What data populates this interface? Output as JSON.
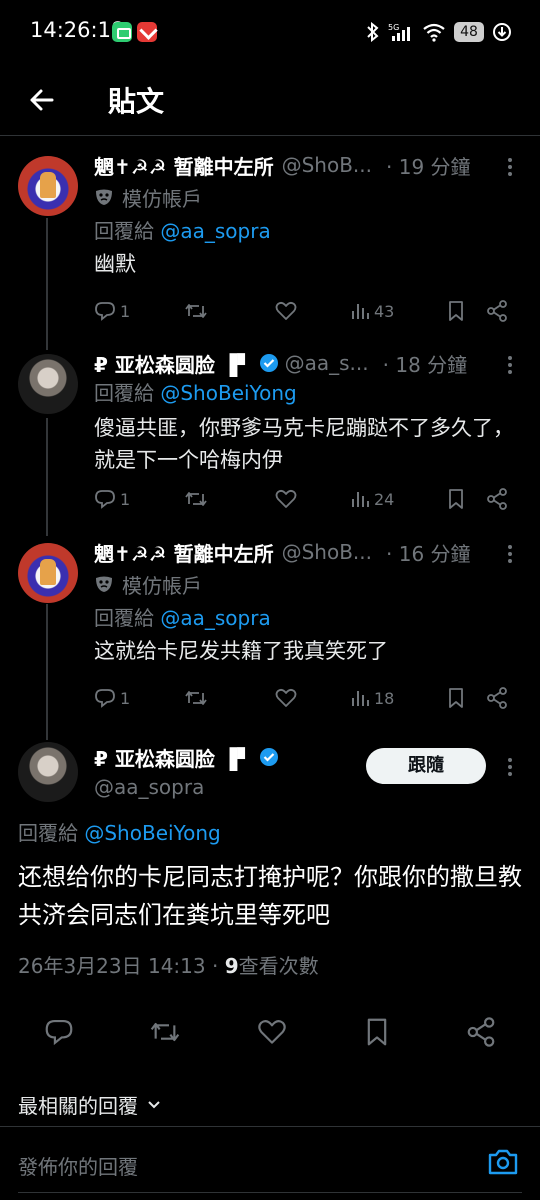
{
  "status_bar": {
    "time": "14:26:18",
    "battery": "48",
    "network": "5G"
  },
  "header": {
    "title": "貼文"
  },
  "tweets": [
    {
      "name": "魍✝☭☭ 暂離中左所",
      "handle": "@ShoB...",
      "time_ago": "· 19 分鐘",
      "parody_label": "模仿帳戶",
      "reply_prefix": "回覆給",
      "reply_to": "@aa_sopra",
      "text": "幽默",
      "replies": "1",
      "views": "43"
    },
    {
      "name": "₽ 亚松森圆脸 ▐▘",
      "handle": "@aa_s...",
      "time_ago": "· 18 分鐘",
      "reply_prefix": "回覆給",
      "reply_to": "@ShoBeiYong",
      "text": "傻逼共匪，你野爹马克卡尼蹦跶不了多久了，就是下一个哈梅内伊",
      "replies": "1",
      "views": "24"
    },
    {
      "name": "魍✝☭☭ 暂離中左所",
      "handle": "@ShoB...",
      "time_ago": "· 16 分鐘",
      "parody_label": "模仿帳戶",
      "reply_prefix": "回覆給",
      "reply_to": "@aa_sopra",
      "text": "这就给卡尼发共籍了我真笑死了",
      "replies": "1",
      "views": "18"
    }
  ],
  "main_post": {
    "name": "₽ 亚松森圆脸 ▐▘",
    "handle": "@aa_sopra",
    "follow_label": "跟隨",
    "reply_prefix": "回覆給",
    "reply_to": "@ShoBeiYong",
    "text": "还想给你的卡尼同志打掩护呢？你跟你的撒旦教共济会同志们在粪坑里等死吧",
    "timestamp": "26年3月23日 14:13 ·",
    "view_count": "9",
    "view_label": "查看次數"
  },
  "replies_sort": {
    "label": "最相關的回覆"
  },
  "composer": {
    "placeholder": "發佈你的回覆"
  },
  "colors": {
    "background": "#000000",
    "accent": "#1d9bf0",
    "secondary_text": "#71767b",
    "divider": "#2f3336"
  }
}
